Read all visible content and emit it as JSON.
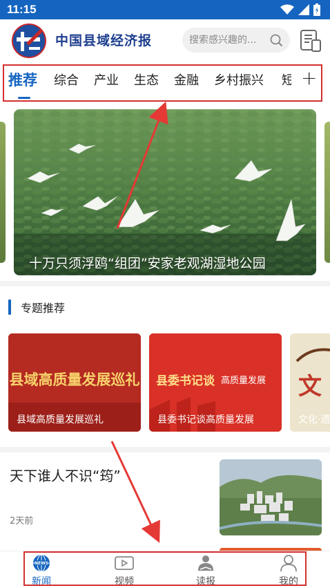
{
  "status_bar": {
    "time": "11:15"
  },
  "header": {
    "logo_text": "中国县域经济报",
    "search_placeholder": "搜索感兴趣的..."
  },
  "tabs": {
    "items": [
      "推荐",
      "综合",
      "产业",
      "生态",
      "金融",
      "乡村振兴"
    ],
    "overflow": "短视频",
    "active_index": 0,
    "add_symbol": "+"
  },
  "carousel": {
    "caption": "十万只须浮鸥“组团”安家老观湖湿地公园"
  },
  "topics_section": {
    "title": "专题推荐",
    "cards": [
      {
        "title": "县域高质量发展巡礼",
        "banner": "县域高质量发展巡礼"
      },
      {
        "title": "县委书记谈高质量发展",
        "banner_main": "县委书记谈",
        "banner_sub": "高质量发展"
      },
      {
        "title": "文化·遗",
        "banner": "文"
      }
    ]
  },
  "news": [
    {
      "title": "天下谁人不识“筠”",
      "time": "2天前"
    }
  ],
  "bottom_nav": {
    "items": [
      {
        "label": "新闻",
        "icon": "news-globe-icon"
      },
      {
        "label": "视频",
        "icon": "video-icon"
      },
      {
        "label": "读报",
        "icon": "reader-icon"
      },
      {
        "label": "我的",
        "icon": "profile-icon"
      }
    ],
    "active_index": 0
  },
  "colors": {
    "brand_blue": "#1565c0",
    "annotation_red": "#d32f2f"
  }
}
